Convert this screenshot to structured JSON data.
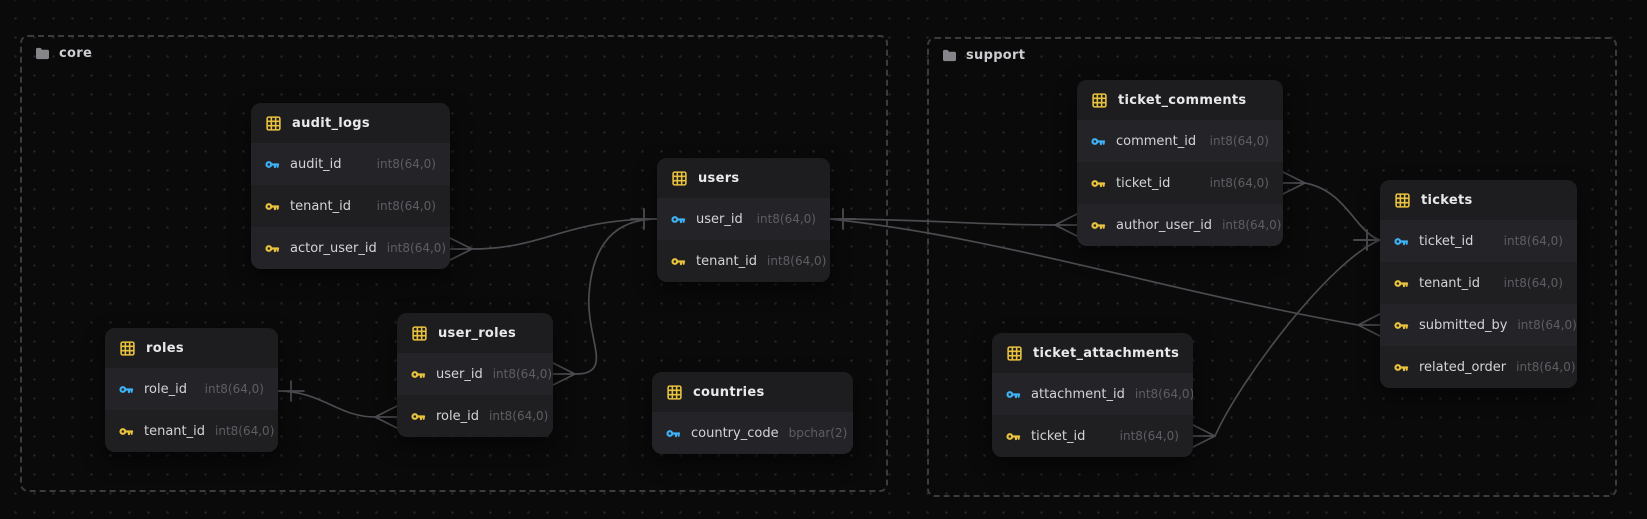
{
  "diagram": {
    "kind": "entity-relationship-diagram"
  },
  "groups": [
    {
      "name": "core"
    },
    {
      "name": "support"
    }
  ],
  "tables": [
    {
      "name": "audit_logs",
      "group": "core",
      "fields": [
        {
          "name": "audit_id",
          "type": "int8(64,0)",
          "key": "primary"
        },
        {
          "name": "tenant_id",
          "type": "int8(64,0)",
          "key": "foreign"
        },
        {
          "name": "actor_user_id",
          "type": "int8(64,0)",
          "key": "foreign"
        }
      ]
    },
    {
      "name": "roles",
      "group": "core",
      "fields": [
        {
          "name": "role_id",
          "type": "int8(64,0)",
          "key": "primary"
        },
        {
          "name": "tenant_id",
          "type": "int8(64,0)",
          "key": "foreign"
        }
      ]
    },
    {
      "name": "user_roles",
      "group": "core",
      "fields": [
        {
          "name": "user_id",
          "type": "int8(64,0)",
          "key": "foreign"
        },
        {
          "name": "role_id",
          "type": "int8(64,0)",
          "key": "foreign"
        }
      ]
    },
    {
      "name": "users",
      "group": "core",
      "fields": [
        {
          "name": "user_id",
          "type": "int8(64,0)",
          "key": "primary"
        },
        {
          "name": "tenant_id",
          "type": "int8(64,0)",
          "key": "foreign"
        }
      ]
    },
    {
      "name": "countries",
      "group": "core",
      "fields": [
        {
          "name": "country_code",
          "type": "bpchar(2)",
          "key": "primary"
        }
      ]
    },
    {
      "name": "ticket_comments",
      "group": "support",
      "fields": [
        {
          "name": "comment_id",
          "type": "int8(64,0)",
          "key": "primary"
        },
        {
          "name": "ticket_id",
          "type": "int8(64,0)",
          "key": "foreign"
        },
        {
          "name": "author_user_id",
          "type": "int8(64,0)",
          "key": "foreign"
        }
      ]
    },
    {
      "name": "ticket_attachments",
      "group": "support",
      "fields": [
        {
          "name": "attachment_id",
          "type": "int8(64,0)",
          "key": "primary"
        },
        {
          "name": "ticket_id",
          "type": "int8(64,0)",
          "key": "foreign"
        }
      ]
    },
    {
      "name": "tickets",
      "group": "support",
      "fields": [
        {
          "name": "ticket_id",
          "type": "int8(64,0)",
          "key": "primary"
        },
        {
          "name": "tenant_id",
          "type": "int8(64,0)",
          "key": "foreign"
        },
        {
          "name": "submitted_by",
          "type": "int8(64,0)",
          "key": "foreign"
        },
        {
          "name": "related_order",
          "type": "int8(64,0)",
          "key": "foreign"
        }
      ]
    }
  ],
  "relationships": [
    {
      "from": "users.user_id",
      "to": "audit_logs.actor_user_id",
      "cardinality": "one-to-many"
    },
    {
      "from": "users.user_id",
      "to": "user_roles.user_id",
      "cardinality": "one-to-many"
    },
    {
      "from": "roles.role_id",
      "to": "user_roles.role_id",
      "cardinality": "one-to-many"
    },
    {
      "from": "users.user_id",
      "to": "ticket_comments.author_user_id",
      "cardinality": "one-to-many"
    },
    {
      "from": "users.user_id",
      "to": "tickets.submitted_by",
      "cardinality": "one-to-many"
    },
    {
      "from": "tickets.ticket_id",
      "to": "ticket_comments.ticket_id",
      "cardinality": "one-to-many"
    },
    {
      "from": "tickets.ticket_id",
      "to": "ticket_attachments.ticket_id",
      "cardinality": "one-to-many"
    }
  ],
  "icons": {
    "table_icon": "grid",
    "folder_icon": "folder",
    "primary_key_icon": "key",
    "foreign_key_icon": "key"
  },
  "colors": {
    "background": "#0a0a0b",
    "primary_key": "#3fb1f5",
    "foreign_key": "#e9c23e",
    "table_icon": "#e9c23e",
    "folder_icon": "#85858a",
    "edge": "#4b4b50",
    "group_border": "#3c3c40"
  }
}
